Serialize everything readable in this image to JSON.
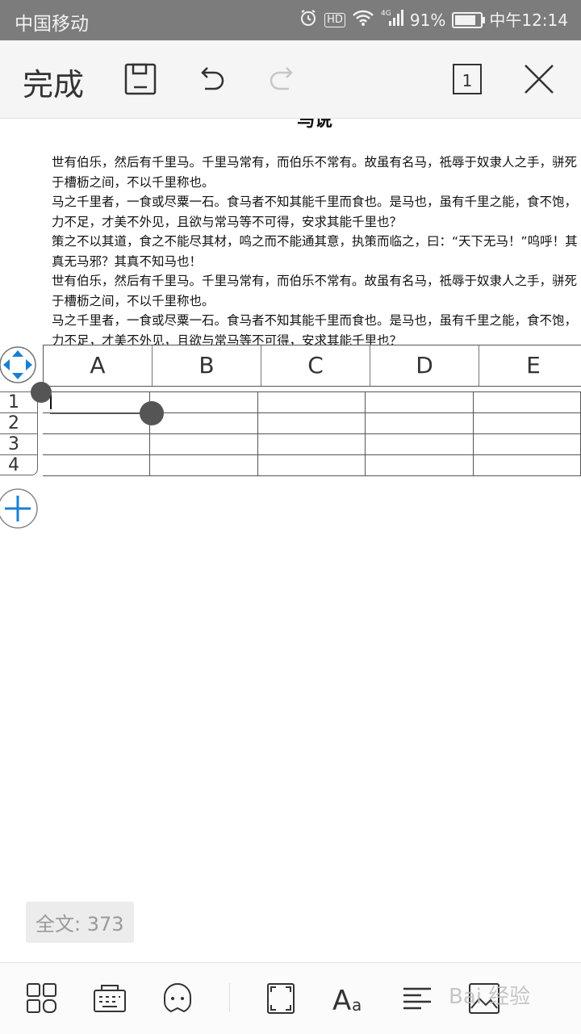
{
  "status_bar": {
    "carrier": "中国移动",
    "hd": "HD",
    "network": "4G",
    "battery": "91%",
    "battery_level": 0.91,
    "time": "中午12:14"
  },
  "toolbar": {
    "done_label": "完成",
    "page_count": "1"
  },
  "document": {
    "title": "马说",
    "paragraphs": [
      "世有伯乐，然后有千里马。千里马常有，而伯乐不常有。故虽有名马，祗辱于奴隶人之手，骈死于槽枥之间，不以千里称也。",
      "马之千里者，一食或尽粟一石。食马者不知其能千里而食也。是马也，虽有千里之能，食不饱，力不足，才美不外见，且欲与常马等不可得，安求其能千里也？",
      "策之不以其道，食之不能尽其材，鸣之而不能通其意，执策而临之，曰：“天下无马！”呜呼！其真无马邪？其真不知马也！",
      " 世有伯乐，然后有千里马。千里马常有，而伯乐不常有。故虽有名马，祗辱于奴隶人之手，骈死于槽枥之间，不以千里称也。",
      "马之千里者，一食或尽粟一石。食马者不知其能千里而食也。是马也，虽有千里之能，食不饱，力不足，才美不外见，且欲与常马等不可得，安求其能千里也？"
    ]
  },
  "table": {
    "columns": [
      "A",
      "B",
      "C",
      "D",
      "E"
    ],
    "rows": [
      "1",
      "2",
      "3",
      "4"
    ]
  },
  "word_count": "全文: 373",
  "watermark": "Bai 经验",
  "colors": {
    "accent": "#1a7fd4",
    "status_bar": "#7c7c7c",
    "handle": "#555555"
  }
}
